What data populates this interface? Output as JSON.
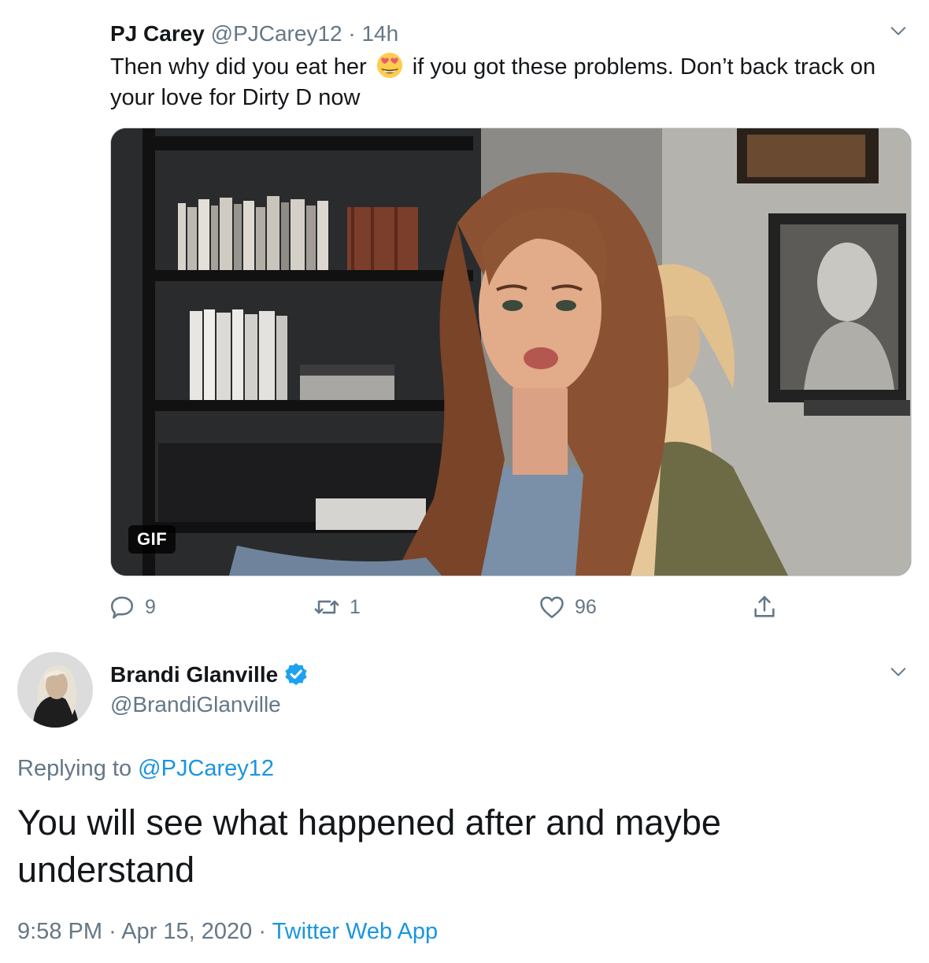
{
  "colors": {
    "link": "#1b95e0",
    "muted": "#657786",
    "text": "#14171a",
    "verified": "#1da1f2"
  },
  "tweet": {
    "author_name": "PJ Carey",
    "author_handle": "@PJCarey12",
    "separator": "·",
    "time": "14h",
    "text_before_emoji": "Then why did you eat her",
    "emoji": "heart-eyes-emoji",
    "text_after_emoji": "if you got these problems. Don’t back track on your love for Dirty D now",
    "media_badge": "GIF",
    "stats": {
      "replies": "9",
      "retweets": "1",
      "likes": "96"
    },
    "icons": [
      "reply-icon",
      "retweet-icon",
      "like-icon",
      "share-icon",
      "chevron-down-icon"
    ]
  },
  "reply": {
    "author_name": "Brandi Glanville",
    "author_handle": "@BrandiGlanville",
    "verified": true,
    "replying_to_prefix": "Replying to",
    "replying_to_handle": "@PJCarey12",
    "text": "You will see what happened after and maybe understand",
    "time": "9:58 PM",
    "separator": "·",
    "date": "Apr 15, 2020",
    "source": "Twitter Web App"
  }
}
